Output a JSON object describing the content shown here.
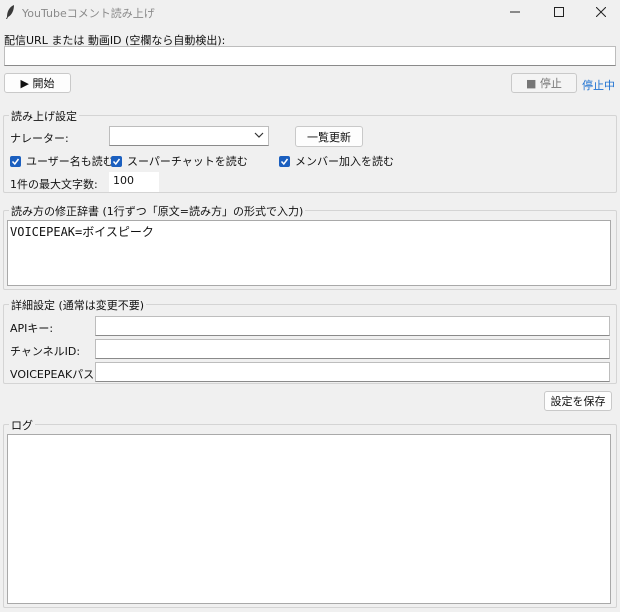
{
  "window": {
    "title": "YouTubeコメント読み上げ"
  },
  "url": {
    "label": "配信URL または 動画ID (空欄なら自動検出):",
    "value": ""
  },
  "controls": {
    "start_label": "▶ 開始",
    "stop_label": "■ 停止",
    "status_text": "停止中",
    "status_color": "#1a6fd1"
  },
  "reading": {
    "group_title": "読み上げ設定",
    "narrator_label": "ナレーター:",
    "narrator_value": "",
    "refresh_label": "一覧更新",
    "checkboxes": [
      {
        "label": "ユーザー名も読む",
        "checked": true
      },
      {
        "label": "スーパーチャットを読む",
        "checked": true
      },
      {
        "label": "メンバー加入を読む",
        "checked": true
      }
    ],
    "maxchars_label": "1件の最大文字数:",
    "maxchars_value": "100"
  },
  "dictionary": {
    "group_title": "読み方の修正辞書 (1行ずつ「原文=読み方」の形式で入力)",
    "content": "VOICEPEAK=ボイスピーク"
  },
  "advanced": {
    "group_title": "詳細設定 (通常は変更不要)",
    "api_key_label": "APIキー:",
    "api_key_value": "",
    "channel_label": "チャンネルID:",
    "channel_value": "",
    "path_label": "VOICEPEAKパス:",
    "path_value": ""
  },
  "save_label": "設定を保存",
  "log": {
    "group_title": "ログ",
    "content": ""
  }
}
